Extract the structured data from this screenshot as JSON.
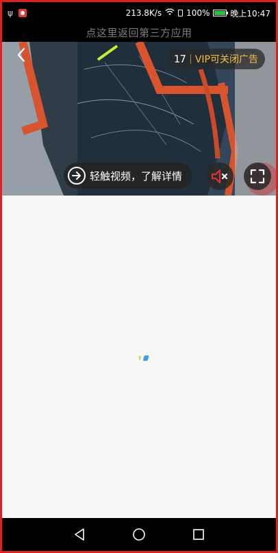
{
  "status_bar": {
    "speed": "213.8K/s",
    "battery": "100%",
    "time": "晚上10:47",
    "icons": [
      "usb-icon",
      "app-notification-icon",
      "wifi-icon",
      "sim-icon",
      "battery-icon"
    ],
    "battery_color": "#25c244"
  },
  "return_bar": {
    "label": "点这里返回第三方应用"
  },
  "video_ad": {
    "countdown": "17",
    "vip_label": "VIP可关闭广告",
    "cta_label": "轻触视频，了解详情",
    "back_icon": "chevron-left-icon",
    "mute_icon": "speaker-muted-icon",
    "fullscreen_icon": "fullscreen-icon",
    "vip_color": "#f2c046",
    "mute_color": "#e23030"
  },
  "loading": {
    "colors": [
      "#b8e05a",
      "#3aa0f0"
    ]
  },
  "nav_bar": {
    "icons": [
      "back-triangle-icon",
      "home-circle-icon",
      "recents-square-icon"
    ]
  }
}
